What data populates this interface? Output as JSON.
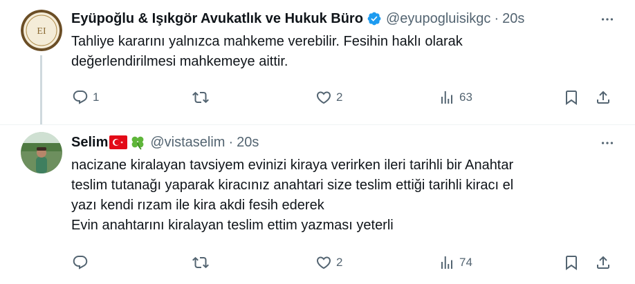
{
  "tweets": [
    {
      "name": "Eyüpoğlu & Işıkgör Avukatlık ve Hukuk Büro",
      "handle": "@eyupogluisikgc",
      "separator": "·",
      "time": "20s",
      "avatar_monogram": "EI",
      "lines": [
        "Tahliye kararını yalnızca mahkeme verebilir. Fesihin haklı olarak",
        "değerlendirilmesi mahkemeye aittir."
      ],
      "replies": "1",
      "retweets": "",
      "likes": "2",
      "views": "63"
    },
    {
      "name": "Selim",
      "handle": "@vistaselim",
      "separator": "·",
      "time": "20s",
      "lines": [
        "nacizane kiralayan tavsiyem evinizi kiraya verirken ileri tarihli bir Anahtar",
        "teslim tutanağı yaparak kiracınız anahtari size teslim ettiği tarihli kiracı el",
        "yazı kendi rızam ile kira akdi fesih ederek",
        "Evin anahtarını kiralayan teslim ettim yazması yeterli"
      ],
      "replies": "",
      "retweets": "",
      "likes": "2",
      "views": "74"
    }
  ],
  "colors": {
    "text": "#0f1419",
    "muted": "#536471",
    "verified": "#1d9bf0",
    "divider": "#eff3f4"
  },
  "icons": [
    "verified-badge-icon",
    "more-icon",
    "reply-icon",
    "retweet-icon",
    "like-icon",
    "views-icon",
    "bookmark-icon",
    "share-icon",
    "turkey-flag-icon",
    "clover-icon"
  ]
}
